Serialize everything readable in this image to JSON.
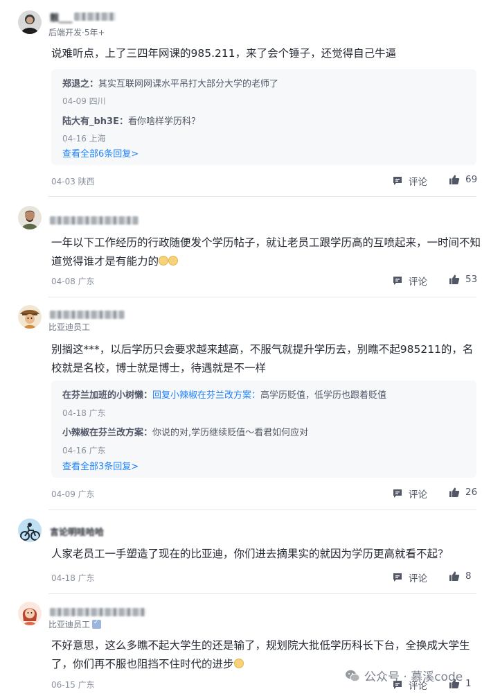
{
  "comments": [
    {
      "author": "靓___ ",
      "meta": "后端开发·5年+",
      "text": "说难听点，上了三四年网课的985.211，来了会个锤子，还觉得自己牛逼",
      "replies": [
        {
          "name": "郑退之：",
          "text": "其实互联网网课水平吊打大部分大学的老师了",
          "meta": "04-09 四川"
        },
        {
          "name": "陆大有_bh3E：",
          "text": "看你啥样学历科？",
          "meta": "04-16 上海"
        }
      ],
      "more": "查看全部6条回复>",
      "footer": "04-03 陕西",
      "comment_label": "评论",
      "likes": "69"
    },
    {
      "text": "一年以下工作经历的行政随便发个学历帖子，就让老员工跟学历高的互喷起来，一时间不知道觉得谁才是有能力的",
      "footer": "04-08 广东",
      "comment_label": "评论",
      "likes": "53"
    },
    {
      "meta": "比亚迪员工",
      "text": "别搁这***，以后学历只会要求越来越高，不服气就提升学历去，别瞧不起985211的，名校就是名校，博士就是博士，待遇就是不一样",
      "replies": [
        {
          "name": "在芬兰加班的小树懒：",
          "link": "回复小辣椒在芬兰改方案：",
          "text": "高学历贬值，低学历也跟着贬值",
          "meta": "04-18 广东"
        },
        {
          "name": "小辣椒在芬兰改方案：",
          "text": "你说的对,学历继续贬值～看君如何应对",
          "meta": "04-16 广东"
        }
      ],
      "more": "查看全部3条回复>",
      "footer": "04-09 广东",
      "comment_label": "评论",
      "likes": "26"
    },
    {
      "author": "言论明哇哈哈",
      "text": "人家老员工一手塑造了现在的比亚迪，你们进去摘果实的就因为学历更高就看不起？",
      "footer": "04-18 广东",
      "comment_label": "评论",
      "likes": "8"
    },
    {
      "meta": "比亚迪员工",
      "text": "不好意思，这么多瞧不起大学生的还是输了，规划院大批低学历科长下台，全换成大学生了，你们再不服也阻挡不住时代的进步",
      "footer": "06-15 广东",
      "comment_label": "评论",
      "likes": "1"
    }
  ],
  "watermark": "公众号 · 慕溪code",
  "colors": {
    "link": "#1e80ff",
    "text": "#252933",
    "muted": "#8a919f",
    "reply_bg": "#f7f8fa"
  }
}
